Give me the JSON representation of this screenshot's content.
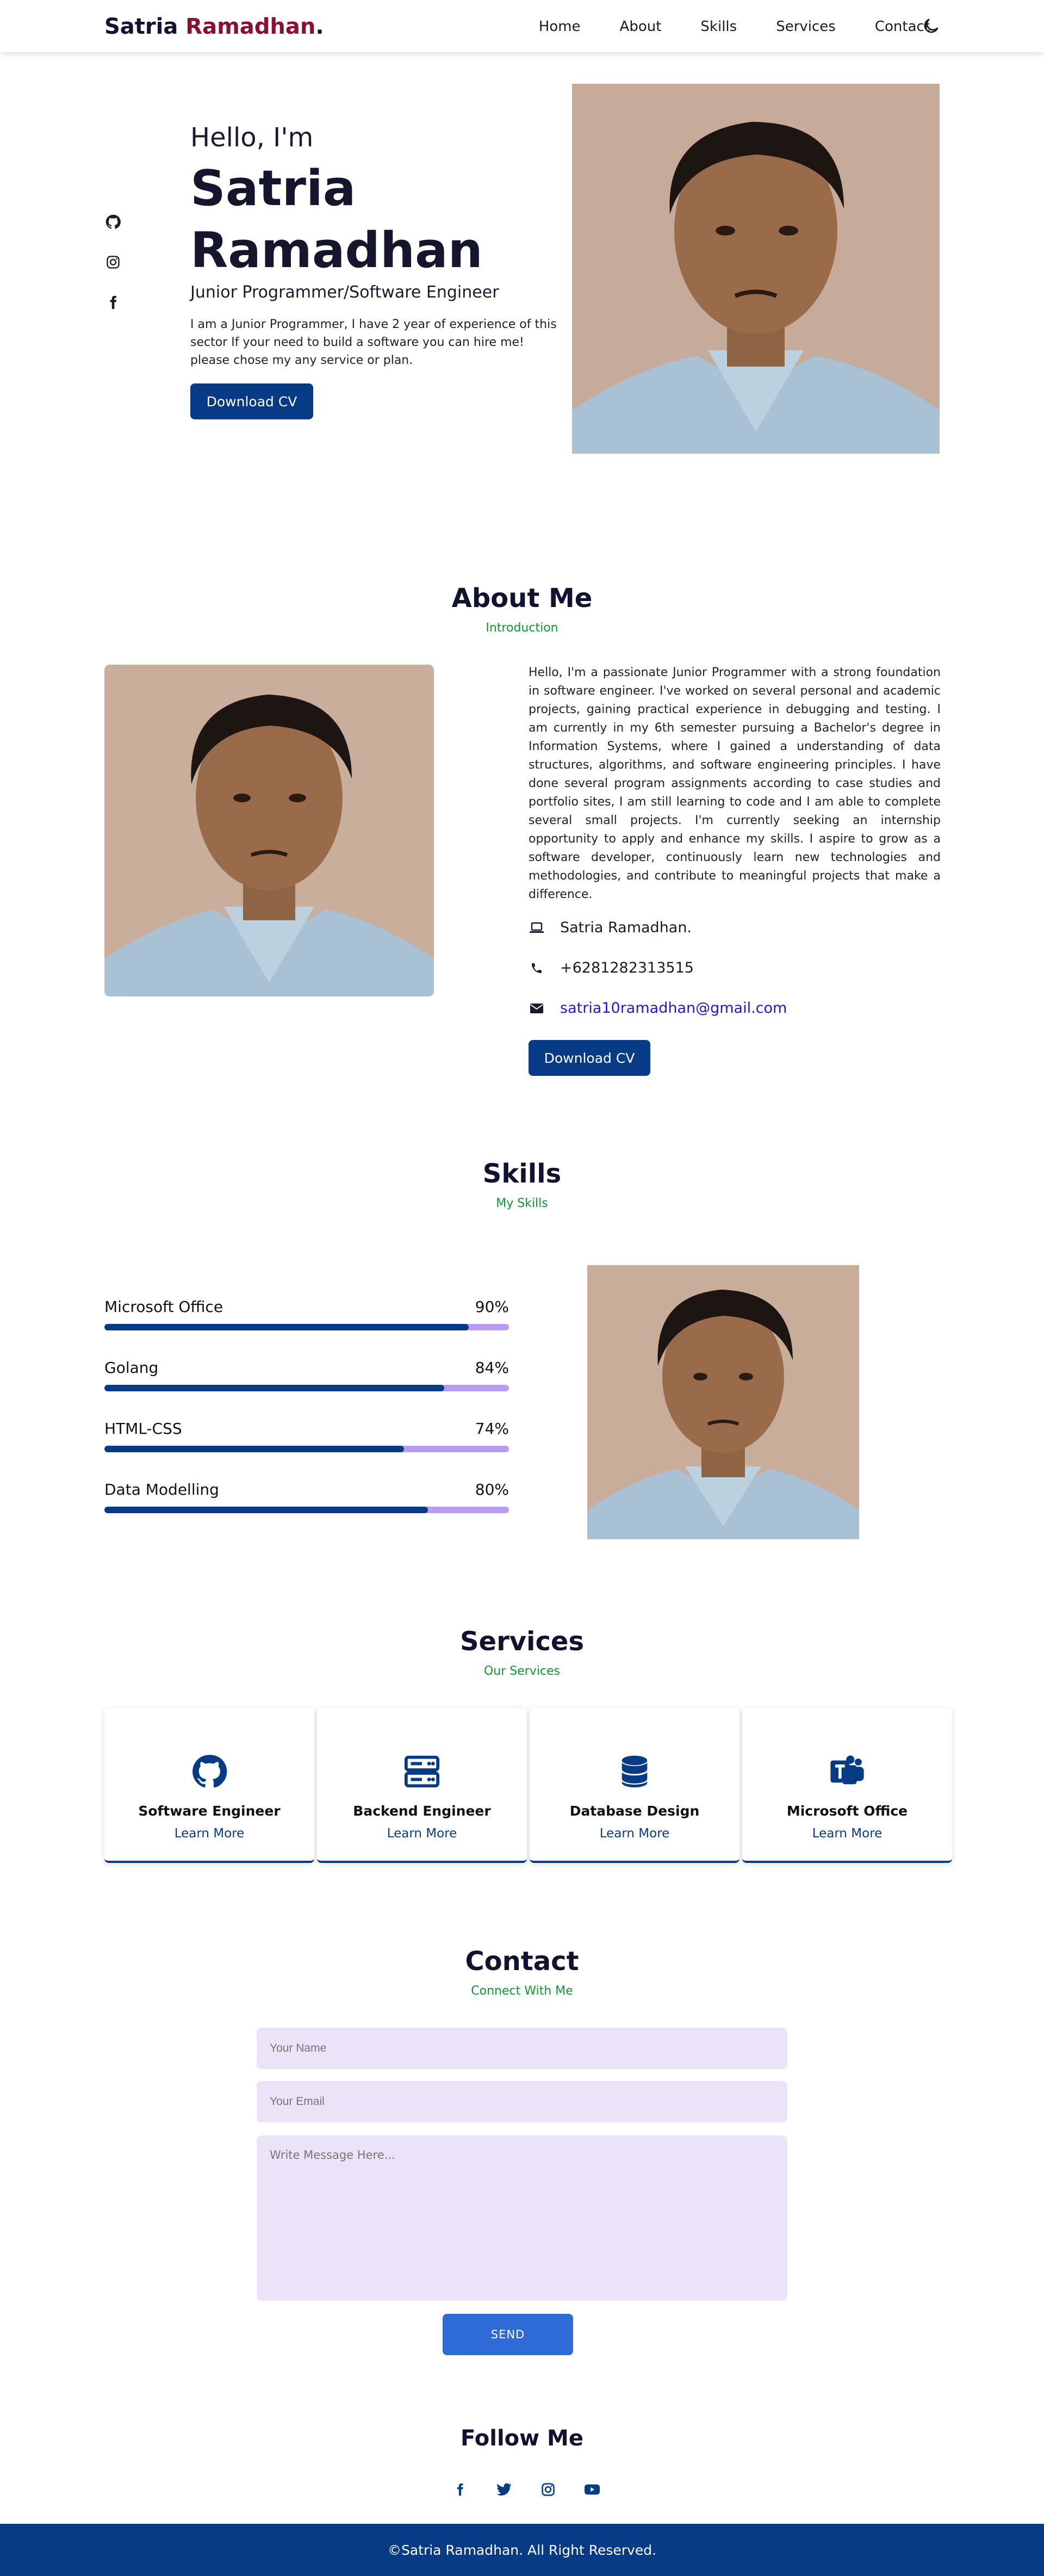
{
  "header": {
    "logo_first": "Satria",
    "logo_second": "Ramadhan",
    "logo_dot": ".",
    "nav": [
      "Home",
      "About",
      "Skills",
      "Services",
      "Contact"
    ],
    "theme_icon": "moon-icon"
  },
  "hero": {
    "greeting": "Hello, I'm",
    "name": "Satria Ramadhan",
    "role": "Junior Programmer/Software Engineer",
    "description": "I am a Junior Programmer, I have 2 year of experience of this sector If your need to build a software you can hire me! please chose my any service or plan.",
    "button": "Download CV",
    "social_icons": [
      "github-icon",
      "instagram-icon",
      "facebook-icon"
    ]
  },
  "about": {
    "title": "About Me",
    "subtitle": "Introduction",
    "text": "Hello, I'm a passionate Junior Programmer with a strong foundation in software engineer. I've worked on several personal and academic projects, gaining practical experience in debugging and testing. I am currently in my 6th semester pursuing a Bachelor's degree in Information Systems, where I gained a understanding of data structures, algorithms, and software engineering principles. I have done several program assignments according to case studies and portfolio sites, I am still learning to code and I am able to complete several small projects. I'm currently seeking an internship opportunity to apply and enhance my skills. I aspire to grow as a software developer, continuously learn new technologies and methodologies, and contribute to meaningful projects that make a difference.",
    "name": "Satria Ramadhan.",
    "phone": "+6281282313515",
    "email": "satria10ramadhan@gmail.com",
    "button": "Download CV"
  },
  "skills": {
    "title": "Skills",
    "subtitle": "My Skills",
    "items": [
      {
        "name": "Microsoft Office",
        "percent_label": "90%",
        "level": 0.9
      },
      {
        "name": "Golang",
        "percent_label": "84%",
        "level": 0.84
      },
      {
        "name": "HTML-CSS",
        "percent_label": "74%",
        "level": 0.74
      },
      {
        "name": "Data Modelling",
        "percent_label": "80%",
        "level": 0.8
      }
    ]
  },
  "services": {
    "title": "Services",
    "subtitle": "Our Services",
    "items": [
      {
        "title": "Software Engineer",
        "link": "Learn More",
        "icon": "github-icon"
      },
      {
        "title": "Backend Engineer",
        "link": "Learn More",
        "icon": "server-icon"
      },
      {
        "title": "Database Design",
        "link": "Learn More",
        "icon": "database-icon"
      },
      {
        "title": "Microsoft Office",
        "link": "Learn More",
        "icon": "teams-icon"
      }
    ]
  },
  "contact": {
    "title": "Contact",
    "subtitle": "Connect With Me",
    "name_placeholder": "Your Name",
    "email_placeholder": "Your Email",
    "message_placeholder": "Write Message Here...",
    "send": "SEND"
  },
  "follow": {
    "title": "Follow Me",
    "icons": [
      "facebook-icon",
      "twitter-icon",
      "instagram-icon",
      "youtube-icon"
    ]
  },
  "footer": {
    "text": "©Satria Ramadhan. All Right Reserved."
  },
  "colors": {
    "primary": "#073b85",
    "accent_red": "#8b0f2f",
    "accent_green": "#0a9a2d",
    "input_bg": "#ebe4f9",
    "progress_track": "#b99cf0",
    "send_button": "#2f6ad9"
  }
}
